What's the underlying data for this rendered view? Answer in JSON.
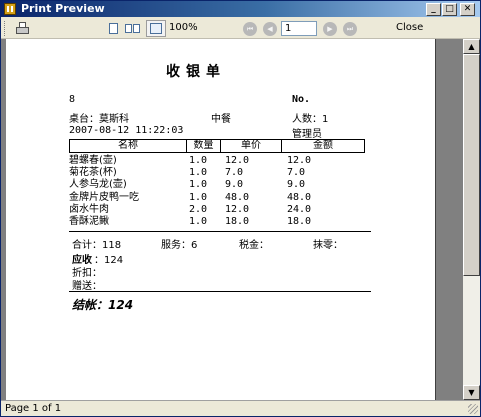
{
  "window": {
    "title": "Print Preview",
    "minimize_glyph": "_",
    "maximize_glyph": "□",
    "close_glyph": "✕"
  },
  "toolbar": {
    "zoom": "100%",
    "page_number": "1",
    "close_label": "Close",
    "nav_first_glyph": "⏮",
    "nav_prev_glyph": "◀",
    "nav_next_glyph": "▶",
    "nav_last_glyph": "⏭",
    "icons": [
      "printer-icon",
      "one-page-icon",
      "two-pages-icon",
      "four-pages-icon"
    ]
  },
  "receipt": {
    "title": "收银单",
    "number_left": "8",
    "number_label": "No.",
    "table_label": "桌台：莫斯科",
    "meal": "中餐",
    "guests": "人数：1",
    "datetime": "2007-08-12 11:22:03",
    "operator": "管理员",
    "columns": [
      "名称",
      "数量",
      "单价",
      "金额"
    ],
    "items": [
      {
        "name": "碧螺春(壶)",
        "qty": "1.0",
        "price": "12.0",
        "amount": "12.0"
      },
      {
        "name": "菊花茶(杯)",
        "qty": "1.0",
        "price": "7.0",
        "amount": "7.0"
      },
      {
        "name": "人参乌龙(壶)",
        "qty": "1.0",
        "price": "9.0",
        "amount": "9.0"
      },
      {
        "name": "金牌片皮鸭一吃",
        "qty": "1.0",
        "price": "48.0",
        "amount": "48.0"
      },
      {
        "name": "卤水牛肉",
        "qty": "2.0",
        "price": "12.0",
        "amount": "24.0"
      },
      {
        "name": "香酥泥鳅",
        "qty": "1.0",
        "price": "18.0",
        "amount": "18.0"
      }
    ],
    "subtotal": "合计：118",
    "service": "服务：6",
    "tax": "税金：",
    "rounding": "抹零：",
    "due_label": "应收",
    "due_value": "：124",
    "discount": "折扣：",
    "gift": "赠送：",
    "settled": "结帐：124"
  },
  "status": {
    "page_info": "Page 1 of 1"
  },
  "scrollbar": {
    "up_glyph": "▲",
    "down_glyph": "▼"
  }
}
